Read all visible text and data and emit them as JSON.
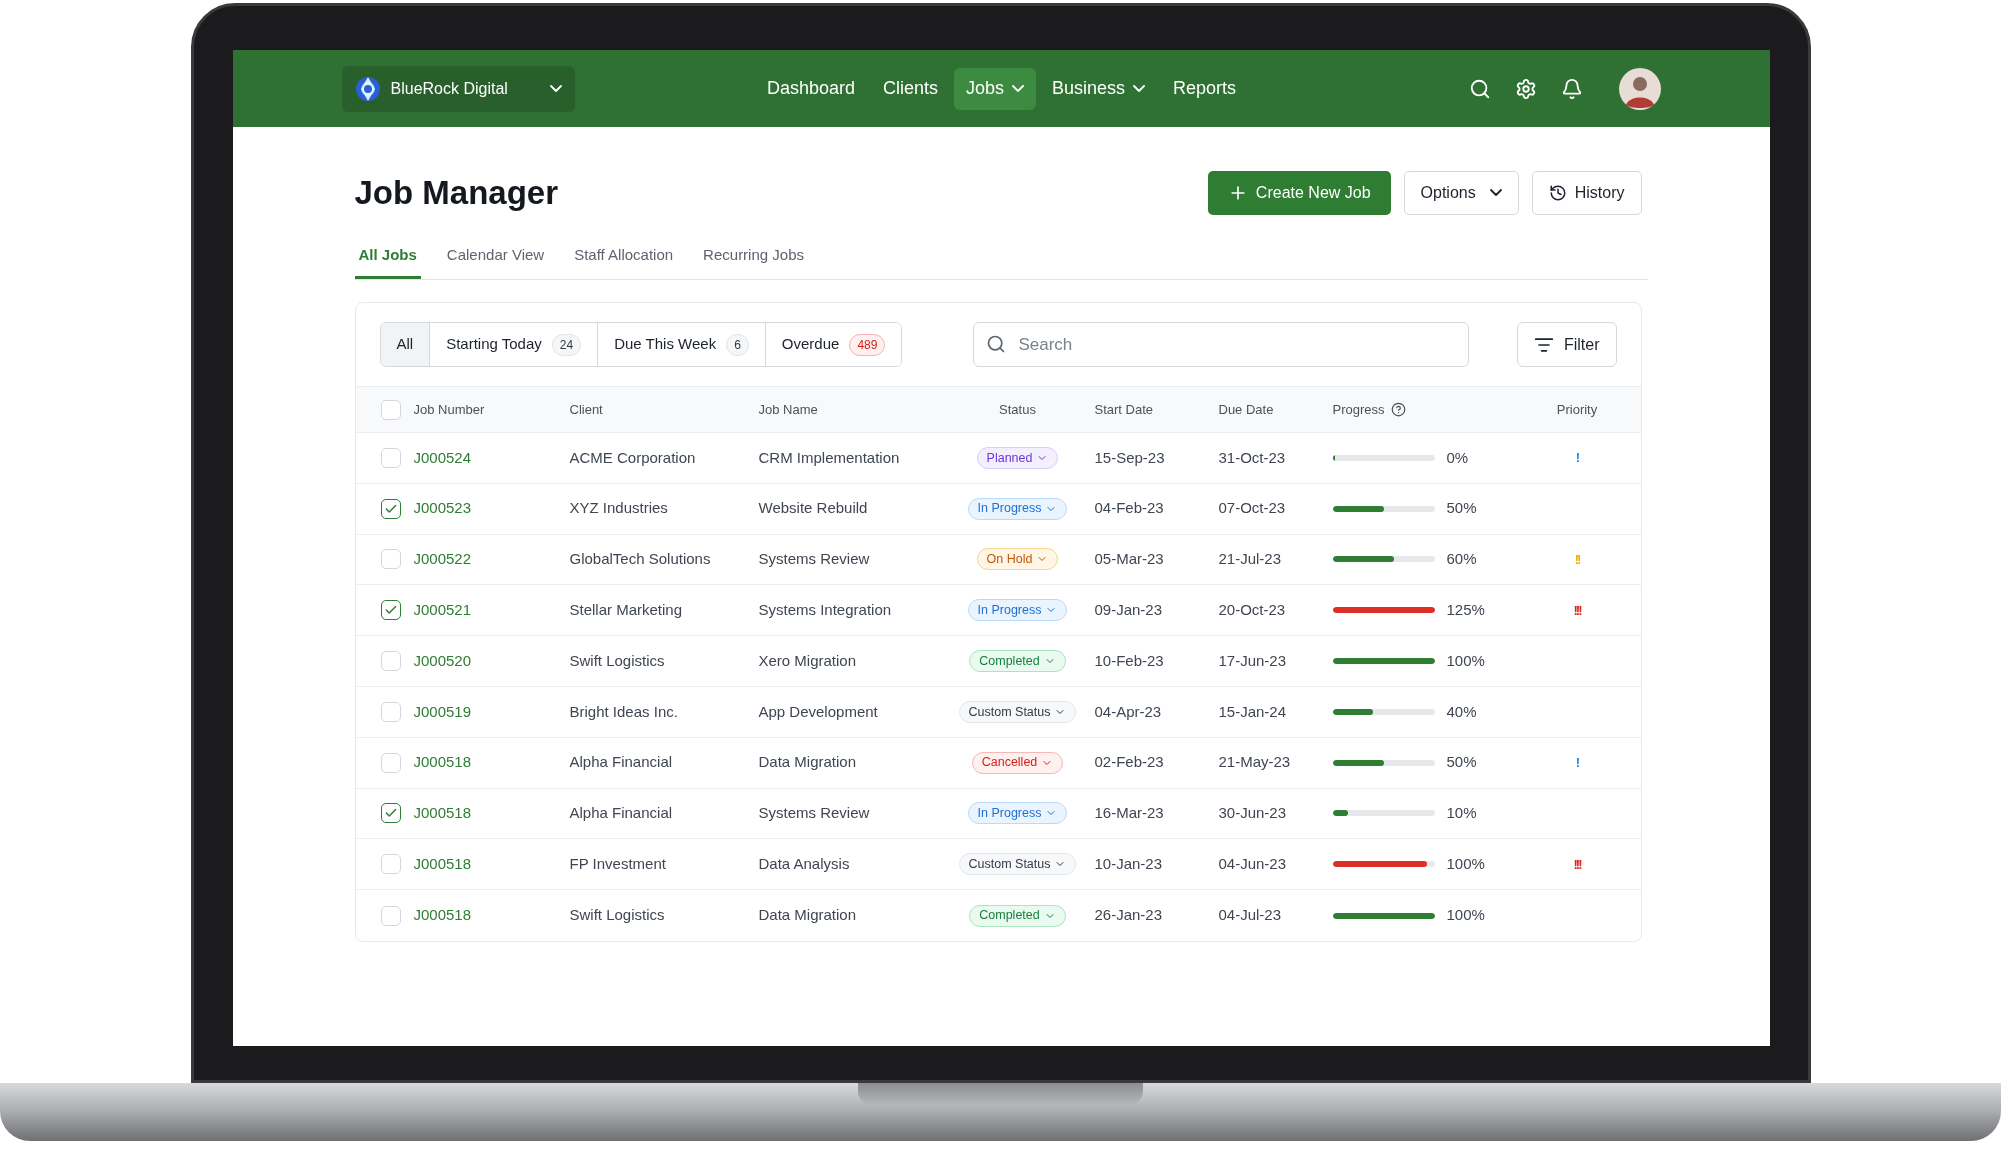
{
  "workspace": {
    "name": "BlueRock Digital"
  },
  "nav": [
    {
      "label": "Dashboard",
      "selected": false,
      "has_menu": false
    },
    {
      "label": "Clients",
      "selected": false,
      "has_menu": false
    },
    {
      "label": "Jobs",
      "selected": true,
      "has_menu": true
    },
    {
      "label": "Business",
      "selected": false,
      "has_menu": true
    },
    {
      "label": "Reports",
      "selected": false,
      "has_menu": false
    }
  ],
  "page": {
    "title": "Job Manager"
  },
  "actions": [
    {
      "label": "Create New Job",
      "kind": "primary"
    },
    {
      "label": "Options",
      "kind": "menu"
    },
    {
      "label": "History",
      "kind": "history"
    }
  ],
  "tabs": [
    {
      "label": "All Jobs",
      "selected": true
    },
    {
      "label": "Calendar View",
      "selected": false
    },
    {
      "label": "Staff Allocation",
      "selected": false
    },
    {
      "label": "Recurring Jobs",
      "selected": false
    }
  ],
  "quick_filters": [
    {
      "label": "All",
      "selected": true
    },
    {
      "label": "Starting Today",
      "count": "24",
      "alert": false,
      "selected": false
    },
    {
      "label": "Due This Week",
      "count": "6",
      "alert": false,
      "selected": false
    },
    {
      "label": "Overdue",
      "count": "489",
      "alert": true,
      "selected": false
    }
  ],
  "search": {
    "placeholder": "Search"
  },
  "filter_button": {
    "label": "Filter"
  },
  "table": {
    "select_all": {
      "checked": false
    },
    "columns": [
      "Job Number",
      "Client",
      "Job Name",
      "Status",
      "Start Date",
      "Due Date",
      "Progress",
      "Priority"
    ],
    "rows": [
      {
        "checked": false,
        "job_number": "J000524",
        "client": "ACME Corporation",
        "job_name": "CRM Implementation",
        "status": {
          "label": "Planned",
          "kind": "planned"
        },
        "start_date": "15-Sep-23",
        "due_date": "31-Oct-23",
        "progress": {
          "level": 0.02,
          "color": "#2f7d32",
          "reading": "0%"
        },
        "priority": {
          "mark": "!",
          "kind": "low"
        }
      },
      {
        "checked": true,
        "job_number": "J000523",
        "client": "XYZ Industries",
        "job_name": "Website Rebuild",
        "status": {
          "label": "In Progress",
          "kind": "in_progress"
        },
        "start_date": "04-Feb-23",
        "due_date": "07-Oct-23",
        "progress": {
          "level": 0.5,
          "color": "#2f7d32",
          "reading": "50%"
        }
      },
      {
        "checked": false,
        "job_number": "J000522",
        "client": "GlobalTech Solutions",
        "job_name": "Systems Review",
        "status": {
          "label": "On Hold",
          "kind": "on_hold"
        },
        "start_date": "05-Mar-23",
        "due_date": "21-Jul-23",
        "progress": {
          "level": 0.6,
          "color": "#2f7d32",
          "reading": "60%"
        },
        "priority": {
          "mark": "!!",
          "kind": "medium"
        }
      },
      {
        "checked": true,
        "job_number": "J000521",
        "client": "Stellar Marketing",
        "job_name": "Systems Integration",
        "status": {
          "label": "In Progress",
          "kind": "in_progress"
        },
        "start_date": "09-Jan-23",
        "due_date": "20-Oct-23",
        "progress": {
          "level": 1,
          "color": "#dc2f25",
          "reading": "125%"
        },
        "priority": {
          "mark": "!!!",
          "kind": "high"
        }
      },
      {
        "checked": false,
        "job_number": "J000520",
        "client": "Swift Logistics",
        "job_name": "Xero Migration",
        "status": {
          "label": "Completed",
          "kind": "completed"
        },
        "start_date": "10-Feb-23",
        "due_date": "17-Jun-23",
        "progress": {
          "level": 1,
          "color": "#2f7d32",
          "reading": "100%"
        }
      },
      {
        "checked": false,
        "job_number": "J000519",
        "client": "Bright Ideas Inc.",
        "job_name": "App Development",
        "status": {
          "label": "Custom Status",
          "kind": "custom"
        },
        "start_date": "04-Apr-23",
        "due_date": "15-Jan-24",
        "progress": {
          "level": 0.4,
          "color": "#2f7d32",
          "reading": "40%"
        }
      },
      {
        "checked": false,
        "job_number": "J000518",
        "client": "Alpha Financial",
        "job_name": "Data Migration",
        "status": {
          "label": "Cancelled",
          "kind": "cancelled"
        },
        "start_date": "02-Feb-23",
        "due_date": "21-May-23",
        "progress": {
          "level": 0.5,
          "color": "#2f7d32",
          "reading": "50%"
        },
        "priority": {
          "mark": "!",
          "kind": "low"
        }
      },
      {
        "checked": true,
        "job_number": "J000518",
        "client": "Alpha Financial",
        "job_name": "Systems Review",
        "status": {
          "label": "In Progress",
          "kind": "in_progress"
        },
        "start_date": "16-Mar-23",
        "due_date": "30-Jun-23",
        "progress": {
          "level": 0.15,
          "color": "#2f7d32",
          "reading": "10%"
        }
      },
      {
        "checked": false,
        "job_number": "J000518",
        "client": "FP Investment",
        "job_name": "Data Analysis",
        "status": {
          "label": "Custom Status",
          "kind": "custom"
        },
        "start_date": "10-Jan-23",
        "due_date": "04-Jun-23",
        "progress": {
          "level": 0.93,
          "color": "#dc2f25",
          "reading": "100%"
        },
        "priority": {
          "mark": "!!!",
          "kind": "high"
        }
      },
      {
        "checked": false,
        "job_number": "J000518",
        "client": "Swift Logistics",
        "job_name": "Data Migration",
        "status": {
          "label": "Completed",
          "kind": "completed"
        },
        "start_date": "26-Jan-23",
        "due_date": "04-Jul-23",
        "progress": {
          "level": 1,
          "color": "#2f7d32",
          "reading": "100%"
        }
      }
    ]
  }
}
